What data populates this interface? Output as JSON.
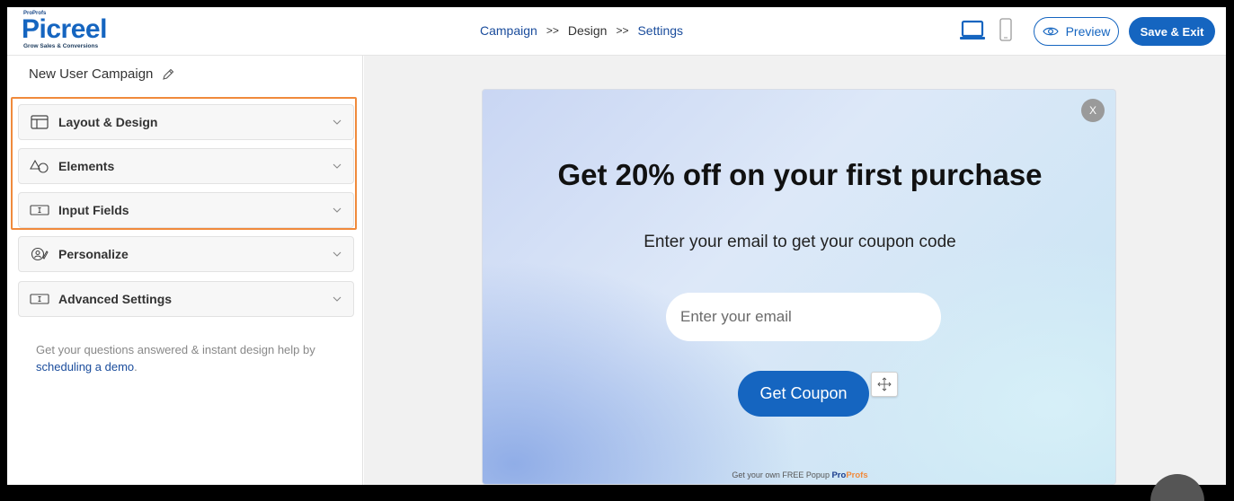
{
  "header": {
    "logo": {
      "top_text": "ProProfs",
      "name": "Picreel",
      "tagline": "Grow Sales & Conversions"
    },
    "breadcrumb": [
      {
        "label": "Campaign"
      },
      {
        "label": "Design"
      },
      {
        "label": "Settings"
      }
    ],
    "breadcrumb_separator": ">>",
    "devices": [
      "laptop-icon",
      "phone-icon"
    ],
    "preview_label": "Preview",
    "save_label": "Save & Exit"
  },
  "sidebar": {
    "campaign_name": "New User Campaign",
    "sections": [
      {
        "label": "Layout & Design",
        "icon": "layout-icon"
      },
      {
        "label": "Elements",
        "icon": "shapes-icon"
      },
      {
        "label": "Input Fields",
        "icon": "input-field-icon"
      },
      {
        "label": "Personalize",
        "icon": "personalize-icon"
      },
      {
        "label": "Advanced Settings",
        "icon": "input-field-icon"
      }
    ],
    "help_text": "Get your questions answered & instant design help by",
    "help_link": "scheduling a demo",
    "help_end": "."
  },
  "popup": {
    "close_label": "X",
    "title": "Get 20% off on your first purchase",
    "subtitle": "Enter your email to get your coupon code",
    "email_placeholder": "Enter your email",
    "button_label": "Get Coupon",
    "powered_text": "Get your own FREE Popup",
    "powered_brand_a": "Pro",
    "powered_brand_b": "Profs"
  },
  "colors": {
    "primary": "#1565c0",
    "highlight": "#f08a3c"
  }
}
